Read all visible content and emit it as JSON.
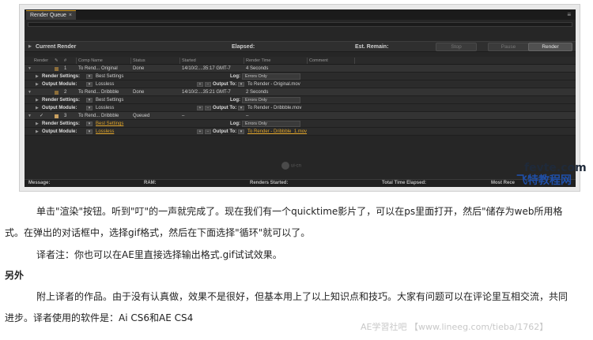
{
  "panel": {
    "tab_label": "Render Queue",
    "tab_close": "×",
    "menu_glyph": "≡",
    "current_render_label": "Current Render",
    "elapsed_label": "Elapsed:",
    "est_remain_label": "Est. Remain:",
    "stop_label": "Stop",
    "pause_label": "Pause",
    "render_label": "Render"
  },
  "columns": {
    "render": "Render",
    "num": "#",
    "comp_name": "Comp Name",
    "status": "Status",
    "started": "Started",
    "render_time": "Render Time",
    "comment": "Comment"
  },
  "items": [
    {
      "num": "1",
      "comp": "To Rend... Original",
      "status": "Done",
      "started": "14/10/2....35:17 GMT-7",
      "render_time": "4 Seconds",
      "check": "",
      "render_settings_label": "Render Settings:",
      "render_settings": "Best Settings",
      "log_label": "Log:",
      "log": "Errors Only",
      "output_module_label": "Output Module:",
      "output_module": "Lossless",
      "output_to_label": "Output To:",
      "output_to": "To Render - Original.mov"
    },
    {
      "num": "2",
      "comp": "To Rend... Dribbble",
      "status": "Done",
      "started": "14/10/2....35:21 GMT-7",
      "render_time": "2 Seconds",
      "check": "",
      "render_settings_label": "Render Settings:",
      "render_settings": "Best Settings",
      "log_label": "Log:",
      "log": "Errors Only",
      "output_module_label": "Output Module:",
      "output_module": "Lossless",
      "output_to_label": "Output To:",
      "output_to": "To Render - Dribbble.mov"
    },
    {
      "num": "3",
      "comp": "To Rend... Dribbble",
      "status": "Queued",
      "started": "–",
      "render_time": "–",
      "check": "✓",
      "render_settings_label": "Render Settings:",
      "render_settings": "Best Settings",
      "log_label": "Log:",
      "log": "Errors Only",
      "output_module_label": "Output Module:",
      "output_module": "Lossless",
      "output_to_label": "Output To:",
      "output_to": "To Render - Dribbble_1.mov"
    }
  ],
  "status_bar": {
    "message": "Message:",
    "ram": "RAM:",
    "renders_started": "Renders Started:",
    "total_elapsed": "Total Time Elapsed:",
    "most_recent": "Most Rece"
  },
  "panel_logo": "ui-cn",
  "watermark": {
    "line1": "fevte.com",
    "line2": "飞特教程网"
  },
  "article": {
    "p1_line1": "单击\"渲染\"按钮。听到\"叮\"的一声就完成了。现在我们有一个quicktime影片了，可以在ps里面打开，然后\"储存为web所用格",
    "p1_line2": "式。在弹出的对话框中，选择gif格式，然后在下面选择\"循环\"就可以了。",
    "note": "译者注：你也可以在AE里直接选择输出格式.gif试试效果。",
    "heading": "另外",
    "p2_line1": "附上译者的作品。由于没有认真做，效果不是很好，但基本用上了以上知识点和技巧。大家有问题可以在评论里互相交流，共同",
    "p2_line2": "进步。译者使用的软件是：Ai CS6和AE CS4",
    "footer_watermark": "AE学習社吧 【www.lineeg.com/tieba/1762】"
  }
}
